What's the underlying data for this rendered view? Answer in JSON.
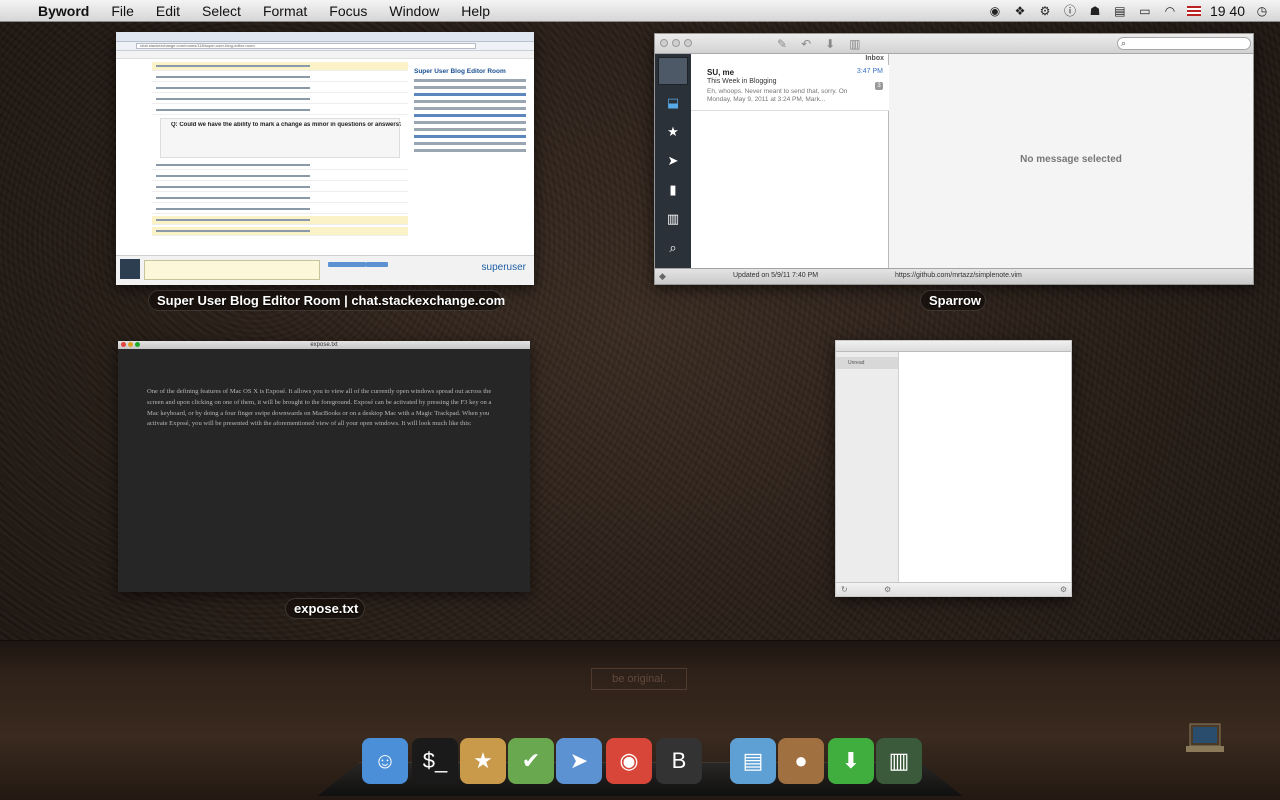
{
  "menubar": {
    "app_name": "Byword",
    "items": [
      "File",
      "Edit",
      "Select",
      "Format",
      "Focus",
      "Window",
      "Help"
    ],
    "clock": "19 40",
    "status_icons": [
      "chrome-ghost-icon",
      "dropbox-icon",
      "gear-icon",
      "info-icon",
      "ghost-icon",
      "notes-icon",
      "battery-icon",
      "wifi-icon",
      "flag-us-icon",
      "time-machine-icon"
    ]
  },
  "windows": {
    "chrome": {
      "label": "Super User Blog Editor Room | chat.stackexchange.com",
      "url": "chat.stackexchange.com/rooms/118/super-user-blog-editor-room",
      "question_title": "Q: Could we have the ability to mark a change as minor in questions or answers?",
      "room_title": "Super User Blog Editor Room",
      "logo": "superuser"
    },
    "sparrow": {
      "label": "Sparrow",
      "inbox": "Inbox",
      "mail": {
        "from": "SU, me",
        "time": "3:47 PM",
        "subject": "This Week in Blogging",
        "preview": "Eh, whoops. Never meant to send that, sorry. On Monday, May 9, 2011 at 3:24 PM, Mark...",
        "count": "3"
      },
      "empty_state": "No message selected",
      "updated": "Updated on 5/9/11 7:40 PM",
      "url": "https://github.com/mrtazz/simplenote.vim"
    },
    "byword": {
      "label": "expose.txt",
      "title": "expose.txt",
      "body": "One of the defining features of Mac OS X is Exposé. It allows you to view all of the currently open windows spread out across the screen and upon clicking on one of them, it will be brought to the foreground. Exposé can be activated by pressing the F3 key on a Mac keyboard, or by doing a four finger swipe downwards on MacBooks or on a desktop Mac with a Magic Trackpad. When you activate Exposé, you will be presented with the aforementioned view of all your open windows. It will look much like this:"
    },
    "empty": {
      "sidebar_item": "Unread"
    }
  },
  "desktop": {
    "stamp": "be original."
  },
  "dock": {
    "items": [
      {
        "name": "finder-icon",
        "glyph": "☺",
        "color": "#4a8fd8"
      },
      {
        "name": "terminal-icon",
        "glyph": "$_",
        "color": "#1a1a1a"
      },
      {
        "name": "package-icon",
        "glyph": "★",
        "color": "#c89a4a"
      },
      {
        "name": "checkmark-app-icon",
        "glyph": "✔",
        "color": "#6aa84f"
      },
      {
        "name": "sparrow-icon",
        "glyph": "➤",
        "color": "#5c92d1"
      },
      {
        "name": "chrome-icon",
        "glyph": "◉",
        "color": "#d8463a"
      },
      {
        "name": "byword-icon",
        "glyph": "B",
        "color": "#333333"
      },
      {
        "name": "archive-icon",
        "glyph": "▤",
        "color": "#5ea0d4"
      },
      {
        "name": "acorn-icon",
        "glyph": "●",
        "color": "#a07040"
      },
      {
        "name": "download-icon",
        "glyph": "⬇",
        "color": "#3fae3f"
      },
      {
        "name": "jar-icon",
        "glyph": "▥",
        "color": "#3b5a3b"
      }
    ]
  }
}
